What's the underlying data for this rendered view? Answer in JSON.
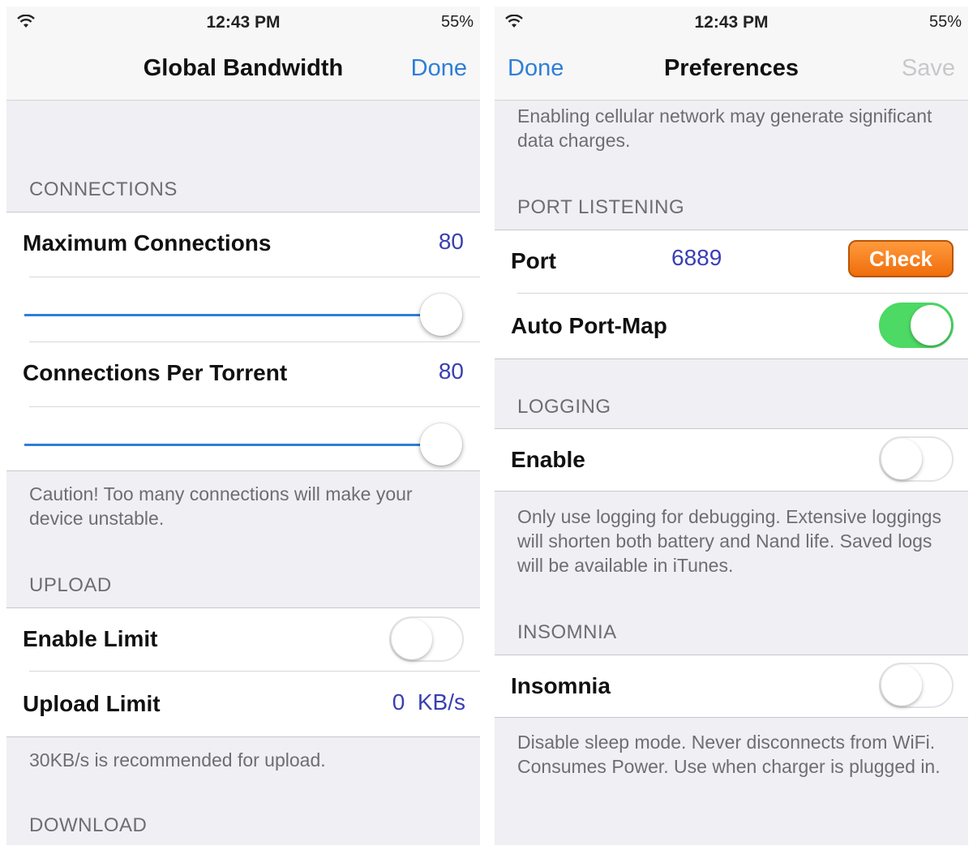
{
  "left_screen": {
    "status": {
      "time": "12:43 PM",
      "battery": "55%"
    },
    "nav": {
      "title": "Global Bandwidth",
      "done_label": "Done"
    },
    "connections": {
      "header": "CONNECTIONS",
      "max_label": "Maximum Connections",
      "max_value": "80",
      "max_slider_level": 1.0,
      "per_torrent_label": "Connections Per Torrent",
      "per_torrent_value": "80",
      "per_torrent_slider_level": 1.0,
      "caution": "Caution! Too many connections will make your device unstable."
    },
    "upload": {
      "header": "UPLOAD",
      "enable_limit_label": "Enable Limit",
      "enable_limit_on": false,
      "limit_label": "Upload Limit",
      "limit_value": "0",
      "limit_unit": "KB/s",
      "note": "30KB/s is recommended for upload."
    },
    "download": {
      "header": "DOWNLOAD"
    }
  },
  "right_screen": {
    "status": {
      "time": "12:43 PM",
      "battery": "55%"
    },
    "nav": {
      "title": "Preferences",
      "done_label": "Done",
      "save_label": "Save"
    },
    "cellular_note": "Enabling cellular network may generate significant data charges.",
    "port_listening": {
      "header": "PORT LISTENING",
      "port_label": "Port",
      "port_value": "6889",
      "check_label": "Check",
      "auto_map_label": "Auto Port-Map",
      "auto_map_on": true
    },
    "logging": {
      "header": "LOGGING",
      "enable_label": "Enable",
      "enable_on": false,
      "note": "Only use logging for debugging. Extensive loggings will shorten both battery and Nand life. Saved logs will be available in iTunes."
    },
    "insomnia": {
      "header": "INSOMNIA",
      "label": "Insomnia",
      "on": false,
      "note": "Disable sleep mode. Never disconnects from WiFi. Consumes Power. Use when charger is plugged in."
    }
  },
  "colors": {
    "accent_blue": "#2f7ed8",
    "value_blue": "#3a3fb0",
    "toggle_green": "#4cd964",
    "check_orange": "#f06d0b",
    "group_background": "#efeff4"
  },
  "icons": {
    "wifi": "wifi-icon"
  }
}
